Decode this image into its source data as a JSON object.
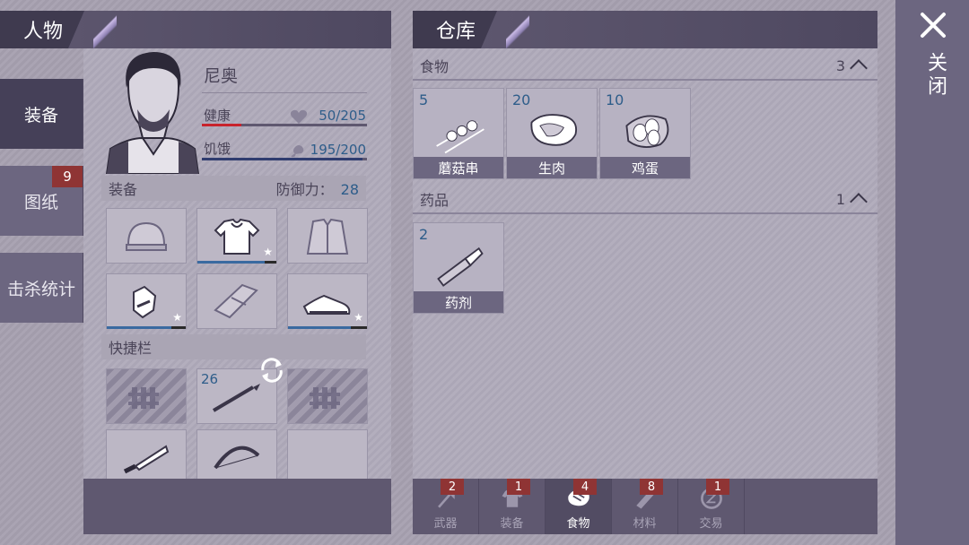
{
  "character_panel": {
    "title": "人物",
    "side_tabs": [
      {
        "label": "装备",
        "active": true
      },
      {
        "label": "图纸",
        "badge": "9"
      },
      {
        "label": "击杀统计"
      }
    ],
    "name": "尼奥",
    "health": {
      "label": "健康",
      "value": "50/205",
      "fraction": 0.24,
      "color": "#c8232c"
    },
    "hunger": {
      "label": "饥饿",
      "value": "195/200",
      "fraction": 0.975,
      "color": "#2f3c6f"
    },
    "equipment": {
      "label": "装备",
      "defense_label": "防御力：",
      "defense_value": "28",
      "slots": [
        {
          "icon": "beanie-icon",
          "durability": null,
          "star": false
        },
        {
          "icon": "tshirt-icon",
          "durability": 0.85,
          "star": true
        },
        {
          "icon": "jacket-icon",
          "durability": null,
          "star": false
        },
        {
          "icon": "gloves-icon",
          "durability": 0.82,
          "star": true
        },
        {
          "icon": "pants-icon",
          "durability": null,
          "star": false
        },
        {
          "icon": "sneakers-icon",
          "durability": 0.8,
          "star": true
        }
      ]
    },
    "hotbar": {
      "label": "快捷栏",
      "slots": [
        {
          "icon": "fence-icon",
          "count": ""
        },
        {
          "icon": "spear-icon",
          "count": "26"
        },
        {
          "icon": "fence-icon",
          "count": ""
        },
        {
          "icon": "machete-icon",
          "count": ""
        },
        {
          "icon": "bow-icon",
          "count": ""
        },
        {
          "icon": "",
          "count": ""
        }
      ]
    }
  },
  "storage_panel": {
    "title": "仓库",
    "categories": [
      {
        "name": "食物",
        "count": "3",
        "items": [
          {
            "count": "5",
            "label": "蘑菇串",
            "icon": "mushroom-skewer-icon"
          },
          {
            "count": "20",
            "label": "生肉",
            "icon": "raw-meat-icon"
          },
          {
            "count": "10",
            "label": "鸡蛋",
            "icon": "eggs-icon"
          }
        ]
      },
      {
        "name": "药品",
        "count": "1",
        "items": [
          {
            "count": "2",
            "label": "药剂",
            "icon": "medicine-stick-icon"
          }
        ]
      }
    ],
    "bottom_tabs": [
      {
        "label": "武器",
        "badge": "2",
        "icon": "axe-icon"
      },
      {
        "label": "装备",
        "badge": "1",
        "icon": "shirt-icon"
      },
      {
        "label": "食物",
        "badge": "4",
        "icon": "meat-icon",
        "active": true
      },
      {
        "label": "材料",
        "badge": "8",
        "icon": "plank-icon"
      },
      {
        "label": "交易",
        "badge": "1",
        "icon": "coin-icon"
      }
    ]
  },
  "close": {
    "label": "关闭",
    "icon": "close-icon"
  }
}
